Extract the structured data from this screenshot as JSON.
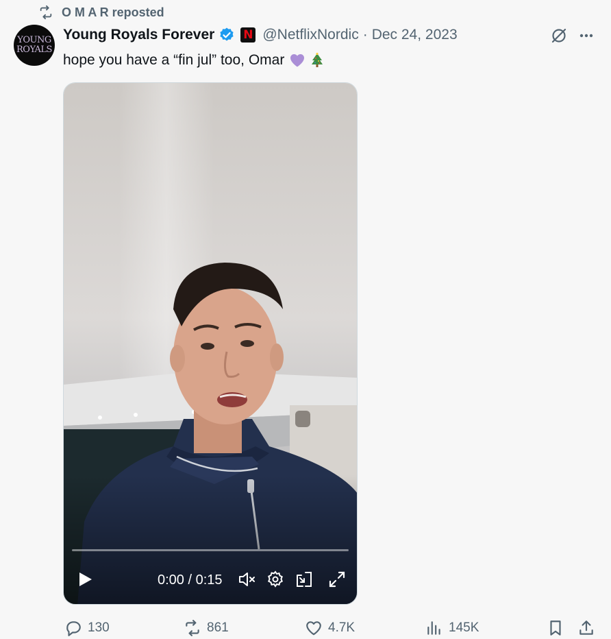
{
  "repost": {
    "label": "O M A R reposted"
  },
  "author": {
    "avatar_text_line1": "YOUNG",
    "avatar_text_line2": "ROYALS",
    "display_name": "Young Royals Forever",
    "affiliate_letter": "N",
    "handle": "@NetflixNordic",
    "separator": "·",
    "date": "Dec 24, 2023",
    "verified_color": "#1d9bf0"
  },
  "tweet": {
    "text": "hope you have a “fin jul” too, Omar"
  },
  "video": {
    "time": "0:00 / 0:15",
    "progress": 0
  },
  "actions": {
    "replies": "130",
    "reposts": "861",
    "likes": "4.7K",
    "views": "145K"
  },
  "icons": [
    "repost-icon",
    "verified-badge-icon",
    "netflix-logo-icon",
    "grok-icon",
    "more-icon",
    "play-icon",
    "mute-icon",
    "settings-icon",
    "pip-icon",
    "fullscreen-icon",
    "reply-icon",
    "like-icon",
    "views-icon",
    "bookmark-icon",
    "share-icon"
  ]
}
